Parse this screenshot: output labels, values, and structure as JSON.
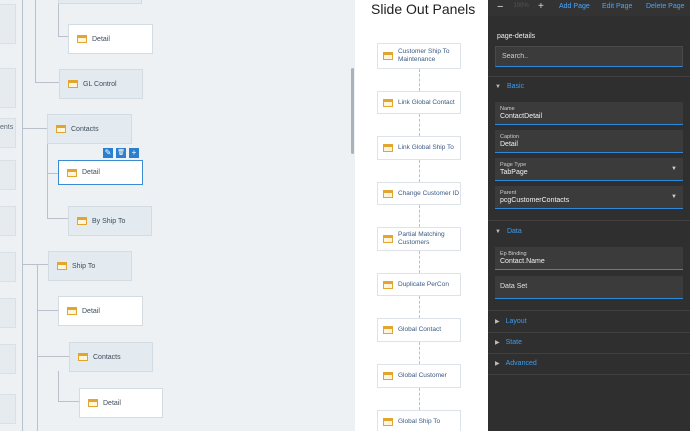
{
  "tree": {
    "edge_label": "ents",
    "nodes": {
      "detail_top": "Detail",
      "gl_control": "GL Control",
      "contacts": "Contacts",
      "detail_selected": "Detail",
      "by_ship_to": "By Ship To",
      "ship_to": "Ship To",
      "detail_ship": "Detail",
      "contacts_ship": "Contacts",
      "detail_bottom": "Detail"
    },
    "tools": {
      "edit": "✎",
      "delete": "🗑",
      "add": "+"
    }
  },
  "slide_out": {
    "title": "Slide Out Panels",
    "panels": [
      "Customer Ship To Maintenance",
      "Link Global Contact",
      "Link Global Ship To",
      "Change Customer ID",
      "Partial Matching Customers",
      "Duplicate PerCon",
      "Global Contact",
      "Global Customer",
      "Global Ship To"
    ]
  },
  "properties": {
    "toolbar": {
      "zoom_minus": "−",
      "zoom_value": "100%",
      "zoom_plus": "+",
      "add_page": "Add Page",
      "edit_page": "Edit Page",
      "delete_page": "Delete Page"
    },
    "title": "page-details",
    "search_placeholder": "Search..",
    "sections": {
      "basic": "Basic",
      "data": "Data",
      "layout": "Layout",
      "state": "State",
      "advanced": "Advanced"
    },
    "fields": {
      "name": {
        "label": "Name",
        "value": "ContactDetail"
      },
      "caption": {
        "label": "Caption",
        "value": "Detail"
      },
      "page_type": {
        "label": "Page Type",
        "value": "TabPage"
      },
      "parent": {
        "label": "Parent",
        "value": "pcgCustomerContacts"
      },
      "ep_binding": {
        "label": "Ep Binding",
        "value": "Contact.Name"
      },
      "data_set": {
        "label": "",
        "value": "Data Set"
      }
    },
    "colors": {
      "accent": "#3d9cf0",
      "panel_bg": "#2f2f2f"
    }
  }
}
